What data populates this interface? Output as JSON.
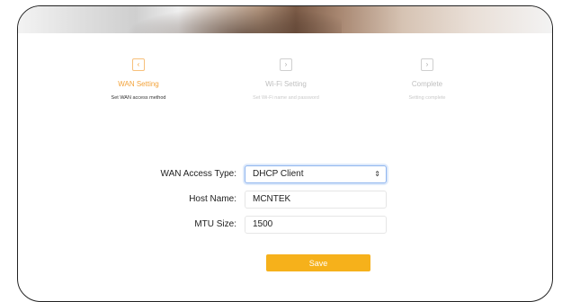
{
  "steps": [
    {
      "icon": "‹",
      "title": "WAN Setting",
      "description": "Set WAN access method"
    },
    {
      "icon": "›",
      "title": "Wi-Fi Setting",
      "description": "Set Wi-Fi name and password"
    },
    {
      "icon": "›",
      "title": "Complete",
      "description": "Setting complete"
    }
  ],
  "form": {
    "wan_access_type": {
      "label": "WAN Access Type:",
      "value": "DHCP Client"
    },
    "host_name": {
      "label": "Host Name:",
      "value": "MCNTEK"
    },
    "mtu_size": {
      "label": "MTU Size:",
      "value": "1500"
    }
  },
  "actions": {
    "save_label": "Save"
  },
  "colors": {
    "accent": "#f6b11b",
    "focus_border": "#8fb5ef"
  },
  "icons": {
    "select_caret": "chevron-updown-icon"
  }
}
